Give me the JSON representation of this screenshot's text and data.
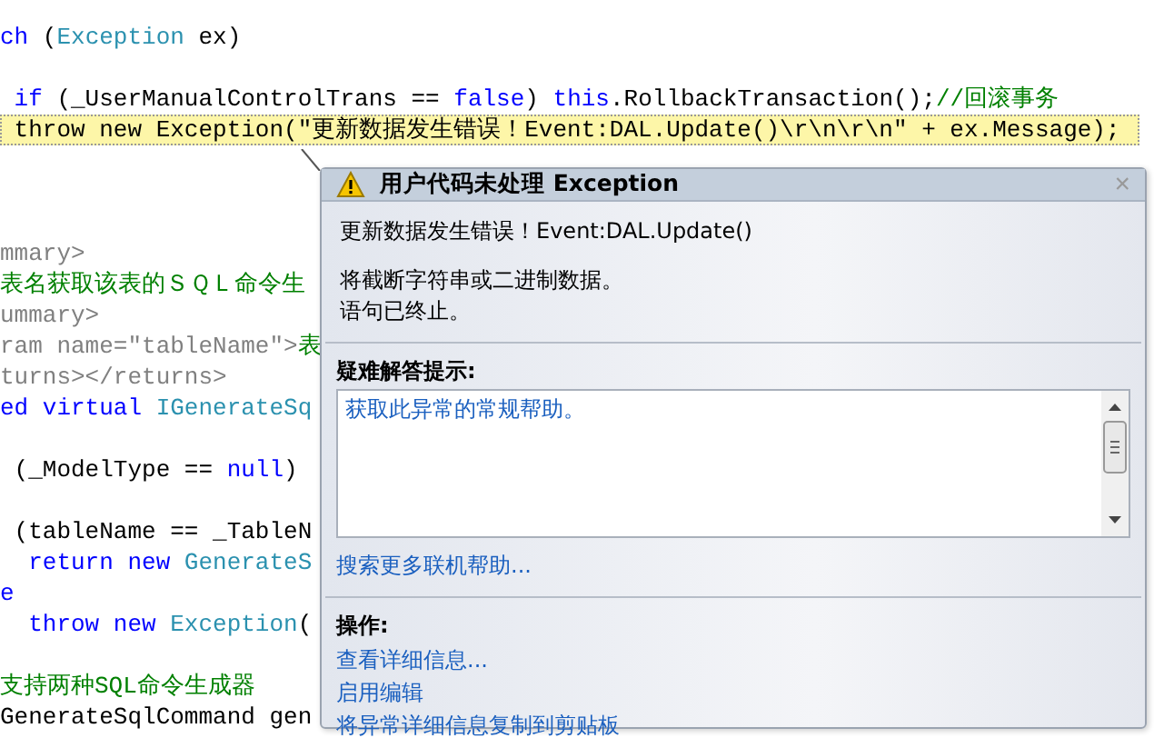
{
  "editor": {
    "lines": [
      {
        "kind": "code",
        "segments": [
          {
            "text": "ch ",
            "kind": "keyword"
          },
          {
            "text": "(",
            "kind": "plain"
          },
          {
            "text": "Exception",
            "kind": "type"
          },
          {
            "text": " ex)",
            "kind": "plain"
          }
        ]
      },
      {
        "kind": "blank"
      },
      {
        "kind": "code",
        "segments": [
          {
            "text": " if",
            "kind": "keyword"
          },
          {
            "text": " (_UserManualControlTrans == ",
            "kind": "plain"
          },
          {
            "text": "false",
            "kind": "keyword"
          },
          {
            "text": ") ",
            "kind": "plain"
          },
          {
            "text": "this",
            "kind": "keyword"
          },
          {
            "text": ".RollbackTransaction();",
            "kind": "plain"
          },
          {
            "text": "//回滚事务",
            "kind": "comment"
          }
        ]
      },
      {
        "kind": "code",
        "highlighted": true,
        "segments": [
          {
            "text": " throw new Exception(\"更新数据发生错误！Event:DAL.Update()\\r\\n\\r\\n\" + ex.Message);",
            "kind": "plain"
          }
        ]
      },
      {
        "kind": "blank"
      },
      {
        "kind": "blank"
      },
      {
        "kind": "blank"
      },
      {
        "kind": "code",
        "segments": [
          {
            "text": "mmary>",
            "kind": "doc"
          }
        ]
      },
      {
        "kind": "code",
        "segments": [
          {
            "text": "表名获取该表的ＳＱＬ命令生",
            "kind": "comment"
          }
        ]
      },
      {
        "kind": "code",
        "segments": [
          {
            "text": "ummary>",
            "kind": "doc"
          }
        ]
      },
      {
        "kind": "code",
        "segments": [
          {
            "text": "ram name=\"tableName\">",
            "kind": "doc"
          },
          {
            "text": "表",
            "kind": "comment"
          }
        ]
      },
      {
        "kind": "code",
        "segments": [
          {
            "text": "turns></returns>",
            "kind": "doc"
          }
        ]
      },
      {
        "kind": "code",
        "segments": [
          {
            "text": "ed virtual",
            "kind": "keyword"
          },
          {
            "text": " IGenerateSq",
            "kind": "type"
          }
        ]
      },
      {
        "kind": "blank"
      },
      {
        "kind": "code",
        "segments": [
          {
            "text": " (_ModelType == ",
            "kind": "plain"
          },
          {
            "text": "null",
            "kind": "keyword"
          },
          {
            "text": ")",
            "kind": "plain"
          }
        ]
      },
      {
        "kind": "blank"
      },
      {
        "kind": "code",
        "segments": [
          {
            "text": " (tableName == _TableN",
            "kind": "plain"
          }
        ]
      },
      {
        "kind": "code",
        "segments": [
          {
            "text": "  return new",
            "kind": "keyword"
          },
          {
            "text": " GenerateS",
            "kind": "type"
          }
        ]
      },
      {
        "kind": "code",
        "segments": [
          {
            "text": "e",
            "kind": "keyword"
          }
        ]
      },
      {
        "kind": "code",
        "segments": [
          {
            "text": "  throw new",
            "kind": "keyword"
          },
          {
            "text": " Exception",
            "kind": "type"
          },
          {
            "text": "(",
            "kind": "plain"
          }
        ]
      },
      {
        "kind": "blank"
      },
      {
        "kind": "code",
        "segments": [
          {
            "text": "支持两种SQL命令生成器",
            "kind": "comment"
          }
        ]
      },
      {
        "kind": "code",
        "segments": [
          {
            "text": "GenerateSqlCommand gen",
            "kind": "plain"
          }
        ]
      }
    ]
  },
  "popup": {
    "title": "用户代码未处理 Exception",
    "close": "×",
    "message": [
      [
        "更新数据发生错误！Event:DAL.Update()"
      ],
      [
        "将截断字符串或二进制数据。",
        "语句已终止。"
      ]
    ],
    "troubleshooting": {
      "heading": "疑难解答提示:",
      "tips": [
        "获取此异常的常规帮助。"
      ],
      "search_link": "搜索更多联机帮助..."
    },
    "actions": {
      "heading": "操作:",
      "links": [
        "查看详细信息...",
        "启用编辑",
        "将异常详细信息复制到剪贴板"
      ]
    }
  }
}
